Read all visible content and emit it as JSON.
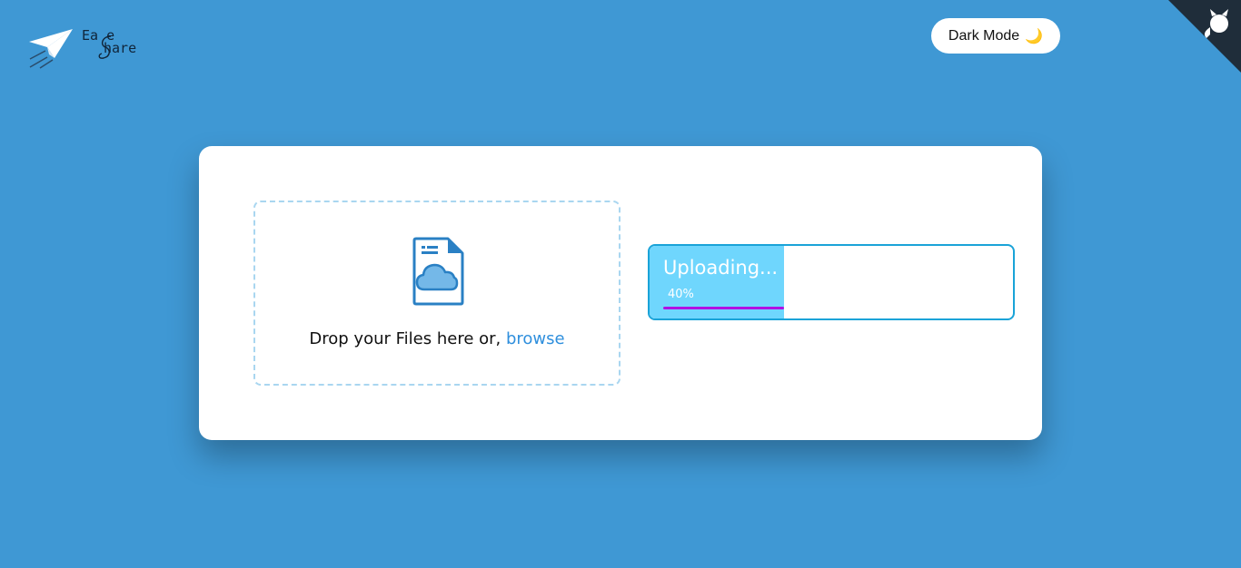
{
  "brand": {
    "line1": "Ea e",
    "line2": "hare",
    "logo_icon": "paper-plane-icon"
  },
  "dark_toggle": {
    "label": "Dark Mode",
    "icon": "🌙"
  },
  "corner_icon": "github-octocat-icon",
  "dropzone": {
    "icon": "cloud-file-icon",
    "text": "Drop your Files here or, ",
    "browse_label": "browse"
  },
  "upload": {
    "title": "Uploading...",
    "percent_label": "40%",
    "progress": 0.4
  },
  "colors": {
    "background": "#3f98d4",
    "progress_fill": "#6fd6fd",
    "progress_line": "#b10fe3",
    "accent": "#2f8fdd"
  }
}
